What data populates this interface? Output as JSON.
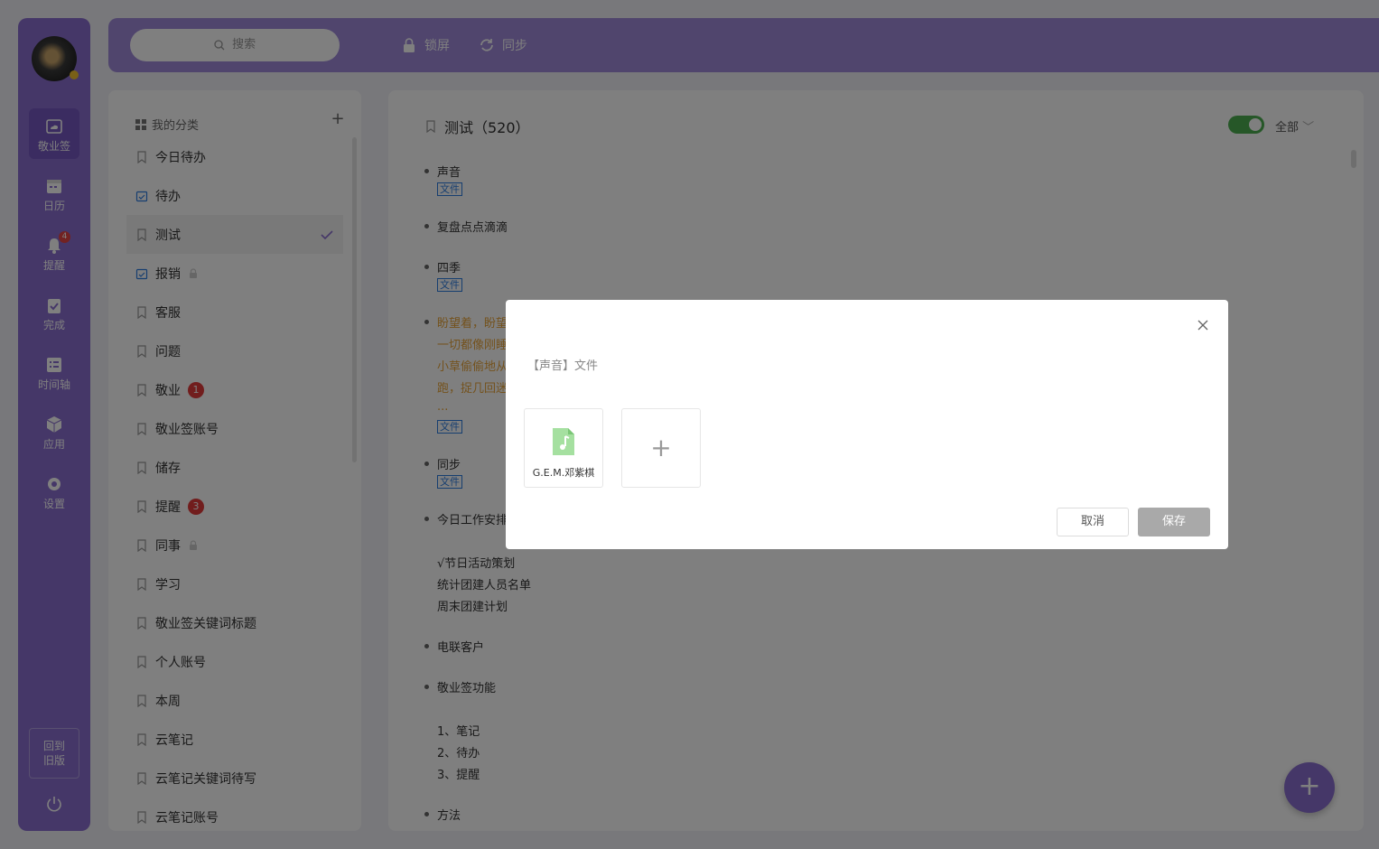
{
  "nav": {
    "items": [
      {
        "label": "敬业签",
        "icon": "note-cloud-icon",
        "active": true
      },
      {
        "label": "日历",
        "icon": "calendar-icon"
      },
      {
        "label": "提醒",
        "icon": "bell-icon",
        "badge": "4"
      },
      {
        "label": "完成",
        "icon": "clipboard-check-icon"
      },
      {
        "label": "时间轴",
        "icon": "timeline-icon"
      },
      {
        "label": "应用",
        "icon": "cube-icon"
      },
      {
        "label": "设置",
        "icon": "gear-icon"
      }
    ],
    "old_version_line1": "回到",
    "old_version_line2": "旧版"
  },
  "topbar": {
    "search_placeholder": "搜索",
    "lock_label": "锁屏",
    "sync_label": "同步"
  },
  "categories": {
    "header": "我的分类",
    "items": [
      {
        "label": "今日待办",
        "icon": "bookmark-icon"
      },
      {
        "label": "待办",
        "icon": "calendar-check-icon"
      },
      {
        "label": "测试",
        "icon": "bookmark-icon",
        "active": true
      },
      {
        "label": "报销",
        "icon": "calendar-check-icon",
        "locked": true
      },
      {
        "label": "客服",
        "icon": "bookmark-icon"
      },
      {
        "label": "问题",
        "icon": "bookmark-icon"
      },
      {
        "label": "敬业",
        "icon": "bookmark-icon",
        "count": "1"
      },
      {
        "label": "敬业签账号",
        "icon": "bookmark-icon"
      },
      {
        "label": "储存",
        "icon": "bookmark-icon"
      },
      {
        "label": "提醒",
        "icon": "bookmark-icon",
        "count": "3"
      },
      {
        "label": "同事",
        "icon": "bookmark-icon",
        "locked": true
      },
      {
        "label": "学习",
        "icon": "bookmark-icon"
      },
      {
        "label": "敬业签关键词标题",
        "icon": "bookmark-icon"
      },
      {
        "label": "个人账号",
        "icon": "bookmark-icon"
      },
      {
        "label": "本周",
        "icon": "bookmark-icon"
      },
      {
        "label": "云笔记",
        "icon": "bookmark-icon"
      },
      {
        "label": "云笔记关键词待写",
        "icon": "bookmark-icon"
      },
      {
        "label": "云笔记账号",
        "icon": "bookmark-icon"
      }
    ]
  },
  "main": {
    "title": "测试（520）",
    "filter_label": "全部",
    "file_tag": "文件",
    "notes": {
      "n1": "声音",
      "n2": "复盘点点滴滴",
      "n3": "四季",
      "n4_l1": "盼望着，盼望",
      "n4_l2": "一切都像刚睡",
      "n4_l3": "小草偷偷地从",
      "n4_l4": "跑，捉几回迷",
      "n4_l5": "...",
      "n5": "同步",
      "n6": "今日工作安排",
      "n6_l1": "√节日活动策划",
      "n6_l2": "统计团建人员名单",
      "n6_l3": "周末团建计划",
      "n7": "电联客户",
      "n8": "敬业签功能",
      "n8_l1": "1、笔记",
      "n8_l2": "2、待办",
      "n8_l3": "3、提醒",
      "n9": "方法"
    }
  },
  "modal": {
    "subtitle": "【声音】文件",
    "file_name": "G.E.M.邓紫棋",
    "cancel_label": "取消",
    "save_label": "保存"
  },
  "colors": {
    "brand_purple": "#8b6fd0",
    "toggle_green": "#4caf50",
    "badge_red": "#e23b3b",
    "file_tag_blue": "#2d7de0",
    "orange_text": "#e8a53b"
  }
}
